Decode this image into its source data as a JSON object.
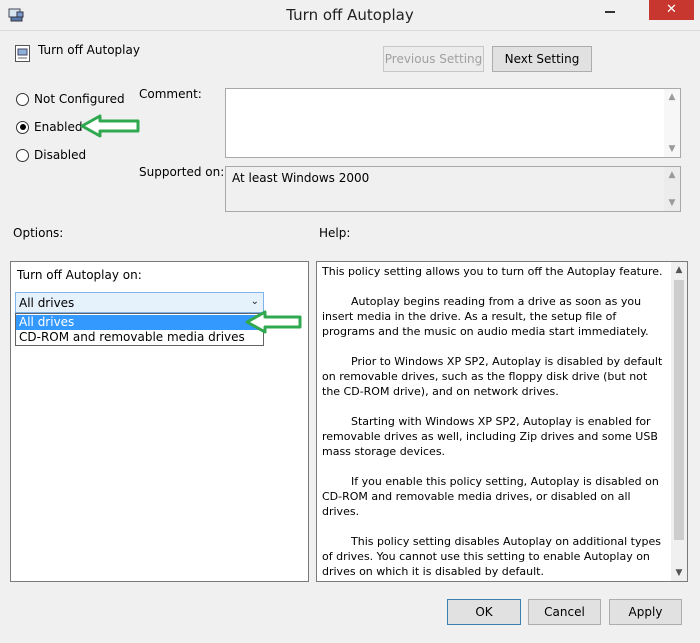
{
  "window": {
    "title": "Turn off Autoplay",
    "close_glyph": "✕"
  },
  "header": {
    "policy_title": "Turn off Autoplay",
    "previous_label": "Previous Setting",
    "next_label": "Next Setting"
  },
  "state": {
    "not_configured_label": "Not Configured",
    "enabled_label": "Enabled",
    "disabled_label": "Disabled",
    "selected": "Enabled"
  },
  "comment": {
    "label": "Comment:",
    "value": ""
  },
  "supported": {
    "label": "Supported on:",
    "value": "At least Windows 2000"
  },
  "options": {
    "heading": "Options:",
    "field_label": "Turn off Autoplay on:",
    "selected_value": "All drives",
    "dropdown_items": [
      "All drives",
      "CD-ROM and removable media drives"
    ]
  },
  "help": {
    "heading": "Help:",
    "paragraphs": [
      "This policy setting allows you to turn off the Autoplay feature.",
      "Autoplay begins reading from a drive as soon as you insert media in the drive. As a result, the setup file of programs and the music on audio media start immediately.",
      "Prior to Windows XP SP2, Autoplay is disabled by default on removable drives, such as the floppy disk drive (but not the CD-ROM drive), and on network drives.",
      "Starting with Windows XP SP2, Autoplay is enabled for removable drives as well, including Zip drives and some USB mass storage devices.",
      "If you enable this policy setting, Autoplay is disabled on CD-ROM and removable media drives, or disabled on all drives.",
      "This policy setting disables Autoplay on additional types of drives. You cannot use this setting to enable Autoplay on drives on which it is disabled by default."
    ]
  },
  "footer": {
    "ok_label": "OK",
    "cancel_label": "Cancel",
    "apply_label": "Apply"
  },
  "colors": {
    "annotation_arrow": "#2fa84f",
    "dropdown_highlight": "#3399ff",
    "close_button": "#c7372f"
  },
  "icons": [
    "app-icon",
    "minimize-icon",
    "close-icon",
    "policy-icon",
    "chevron-down-icon",
    "scroll-up-icon",
    "scroll-down-icon"
  ]
}
